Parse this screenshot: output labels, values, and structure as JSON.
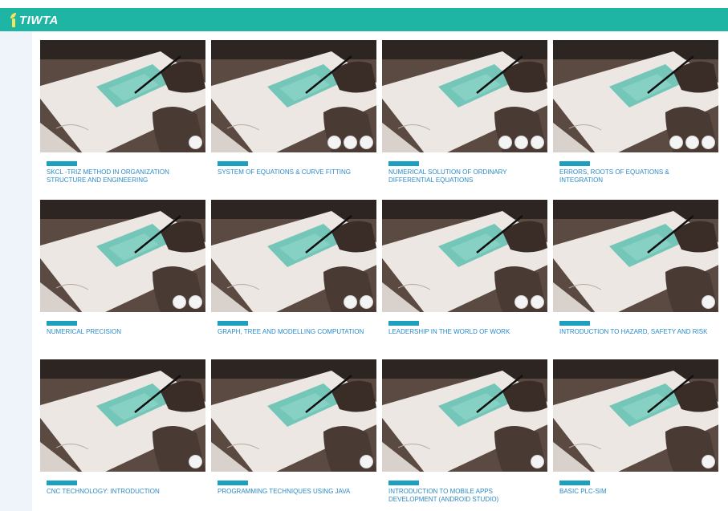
{
  "app": {
    "brand": "TIWTA"
  },
  "colors": {
    "header": "#1fb5a5",
    "category_badge": "#1d9fbf",
    "course_title": "#2a8ac6",
    "sidebar": "#eef4f9"
  },
  "courses": [
    {
      "title": "SKCL -TRIZ METHOD IN ORGANIZATION STRUCTURE AND ENGINEERING",
      "category": "",
      "actions": 1
    },
    {
      "title": "SYSTEM OF EQUATIONS & CURVE FITTING",
      "category": "",
      "actions": 3
    },
    {
      "title": "NUMERICAL SOLUTION OF ORDINARY DIFFERENTIAL EQUATIONS",
      "category": "",
      "actions": 3
    },
    {
      "title": "ERRORS, ROOTS OF EQUATIONS & INTEGRATION",
      "category": "",
      "actions": 3
    },
    {
      "title": "NUMERICAL PRECISION",
      "category": "",
      "actions": 2
    },
    {
      "title": "GRAPH, TREE AND MODELLING COMPUTATION",
      "category": "",
      "actions": 2
    },
    {
      "title": "LEADERSHIP IN THE WORLD OF WORK",
      "category": "",
      "actions": 2
    },
    {
      "title": "INTRODUCTION TO HAZARD, SAFETY AND RISK",
      "category": "",
      "actions": 1
    },
    {
      "title": "CNC TECHNOLOGY: INTRODUCTION",
      "category": "",
      "actions": 1
    },
    {
      "title": "PROGRAMMING TECHNIQUES USING JAVA",
      "category": "",
      "actions": 1
    },
    {
      "title": "INTRODUCTION TO MOBILE APPS DEVELOPMENT (ANDROID STUDIO)",
      "category": "",
      "actions": 1
    },
    {
      "title": "BASIC PLC-SIM",
      "category": "",
      "actions": 1
    }
  ]
}
